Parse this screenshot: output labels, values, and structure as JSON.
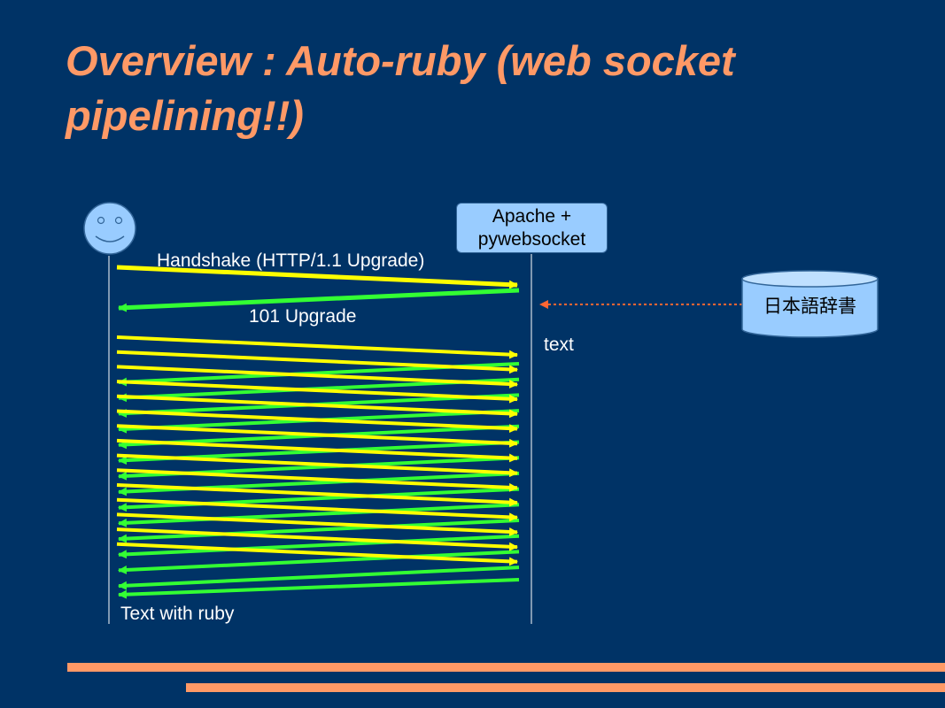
{
  "slide": {
    "title": "Overview : Auto-ruby (web socket pipelining!!)"
  },
  "diagram": {
    "client": {
      "icon": "smiley-face-icon"
    },
    "server": {
      "line1": "Apache +",
      "line2": "pywebsocket"
    },
    "dictionary": {
      "label": "日本語辞書",
      "icon": "database-cylinder-icon"
    },
    "labels": {
      "handshake": "Handshake (HTTP/1.1 Upgrade)",
      "upgrade": "101 Upgrade",
      "text": "text",
      "result": "Text with ruby"
    }
  },
  "colors": {
    "background": "#003366",
    "accent": "#ff9966",
    "request_arrow": "#ffff00",
    "response_arrow": "#33ff33",
    "lifeline": "#ffffff",
    "box_fill": "#99ccff",
    "dictionary_arrow": "#ff6633"
  }
}
